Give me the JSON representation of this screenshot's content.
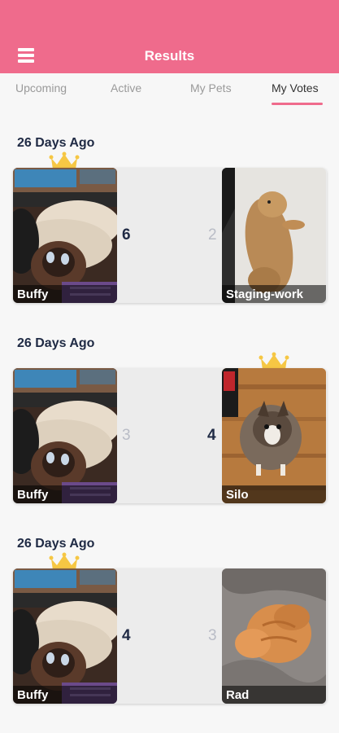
{
  "header": {
    "title": "Results"
  },
  "tabs": [
    {
      "label": "Upcoming"
    },
    {
      "label": "Active"
    },
    {
      "label": "My Pets"
    },
    {
      "label": "My Votes"
    }
  ],
  "active_tab": "My Votes",
  "colors": {
    "brand": "#ef6b8c",
    "crown": "#f6c744",
    "winner_count": "#1f2a44",
    "loser_count": "#b9bcc6"
  },
  "results": [
    {
      "date": "26 Days Ago",
      "left": {
        "name": "Buffy",
        "votes": "6",
        "winner": true
      },
      "right": {
        "name": "Staging-work",
        "votes": "2",
        "winner": false
      }
    },
    {
      "date": "26 Days Ago",
      "left": {
        "name": "Buffy",
        "votes": "3",
        "winner": false
      },
      "right": {
        "name": "Silo",
        "votes": "4",
        "winner": true
      }
    },
    {
      "date": "26 Days Ago",
      "left": {
        "name": "Buffy",
        "votes": "4",
        "winner": true
      },
      "right": {
        "name": "Rad",
        "votes": "3",
        "winner": false
      }
    }
  ]
}
